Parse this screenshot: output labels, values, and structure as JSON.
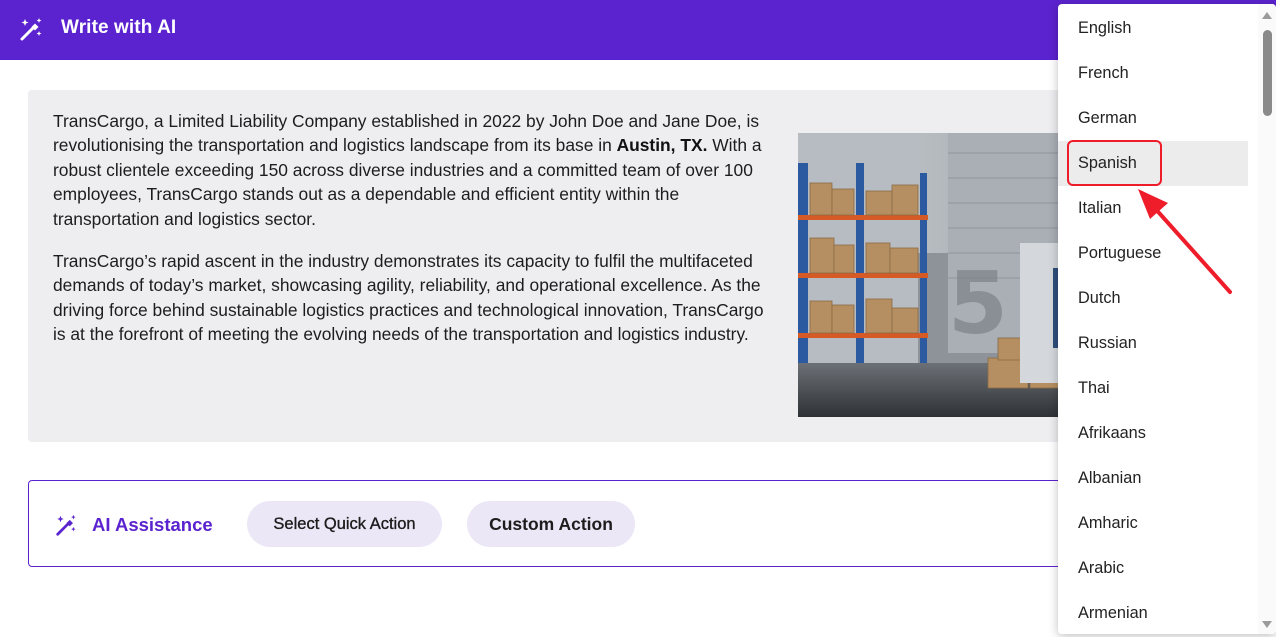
{
  "header": {
    "title": "Write with AI",
    "icon": "magic-wand-icon",
    "background_color": "#5b23cf"
  },
  "content": {
    "para1_before": "TransCargo, a Limited Liability Company established in 2022 by John Doe and Jane Doe, is revolutionising the transportation and logistics landscape from its base in ",
    "para1_bold": "Austin, TX.",
    "para1_after": " With a robust clientele exceeding 150 across diverse industries and a committed team of over 100 employees, TransCargo stands out as a dependable and efficient entity within the transportation and logistics sector.",
    "para2": "TransCargo’s rapid ascent in the industry demonstrates its capacity to fulfil the multifaceted demands of today’s market, showcasing agility, reliability, and operational excellence. As the driving force behind sustainable logistics practices and technological innovation, TransCargo is at the forefront of meeting the evolving needs of the transportation and logistics industry.",
    "image_subject": "warehouse-loading-dock-photo"
  },
  "assistance": {
    "label": "AI Assistance",
    "icon": "magic-wand-icon",
    "quick_action_label": "Select Quick Action",
    "custom_action_label": "Custom Action",
    "accent_color": "#5b23cf"
  },
  "language_dropdown": {
    "options": [
      "English",
      "French",
      "German",
      "Spanish",
      "Italian",
      "Portuguese",
      "Dutch",
      "Russian",
      "Thai",
      "Afrikaans",
      "Albanian",
      "Amharic",
      "Arabic",
      "Armenian"
    ],
    "highlighted": "Spanish",
    "annotation_color": "#ef1c2a"
  }
}
